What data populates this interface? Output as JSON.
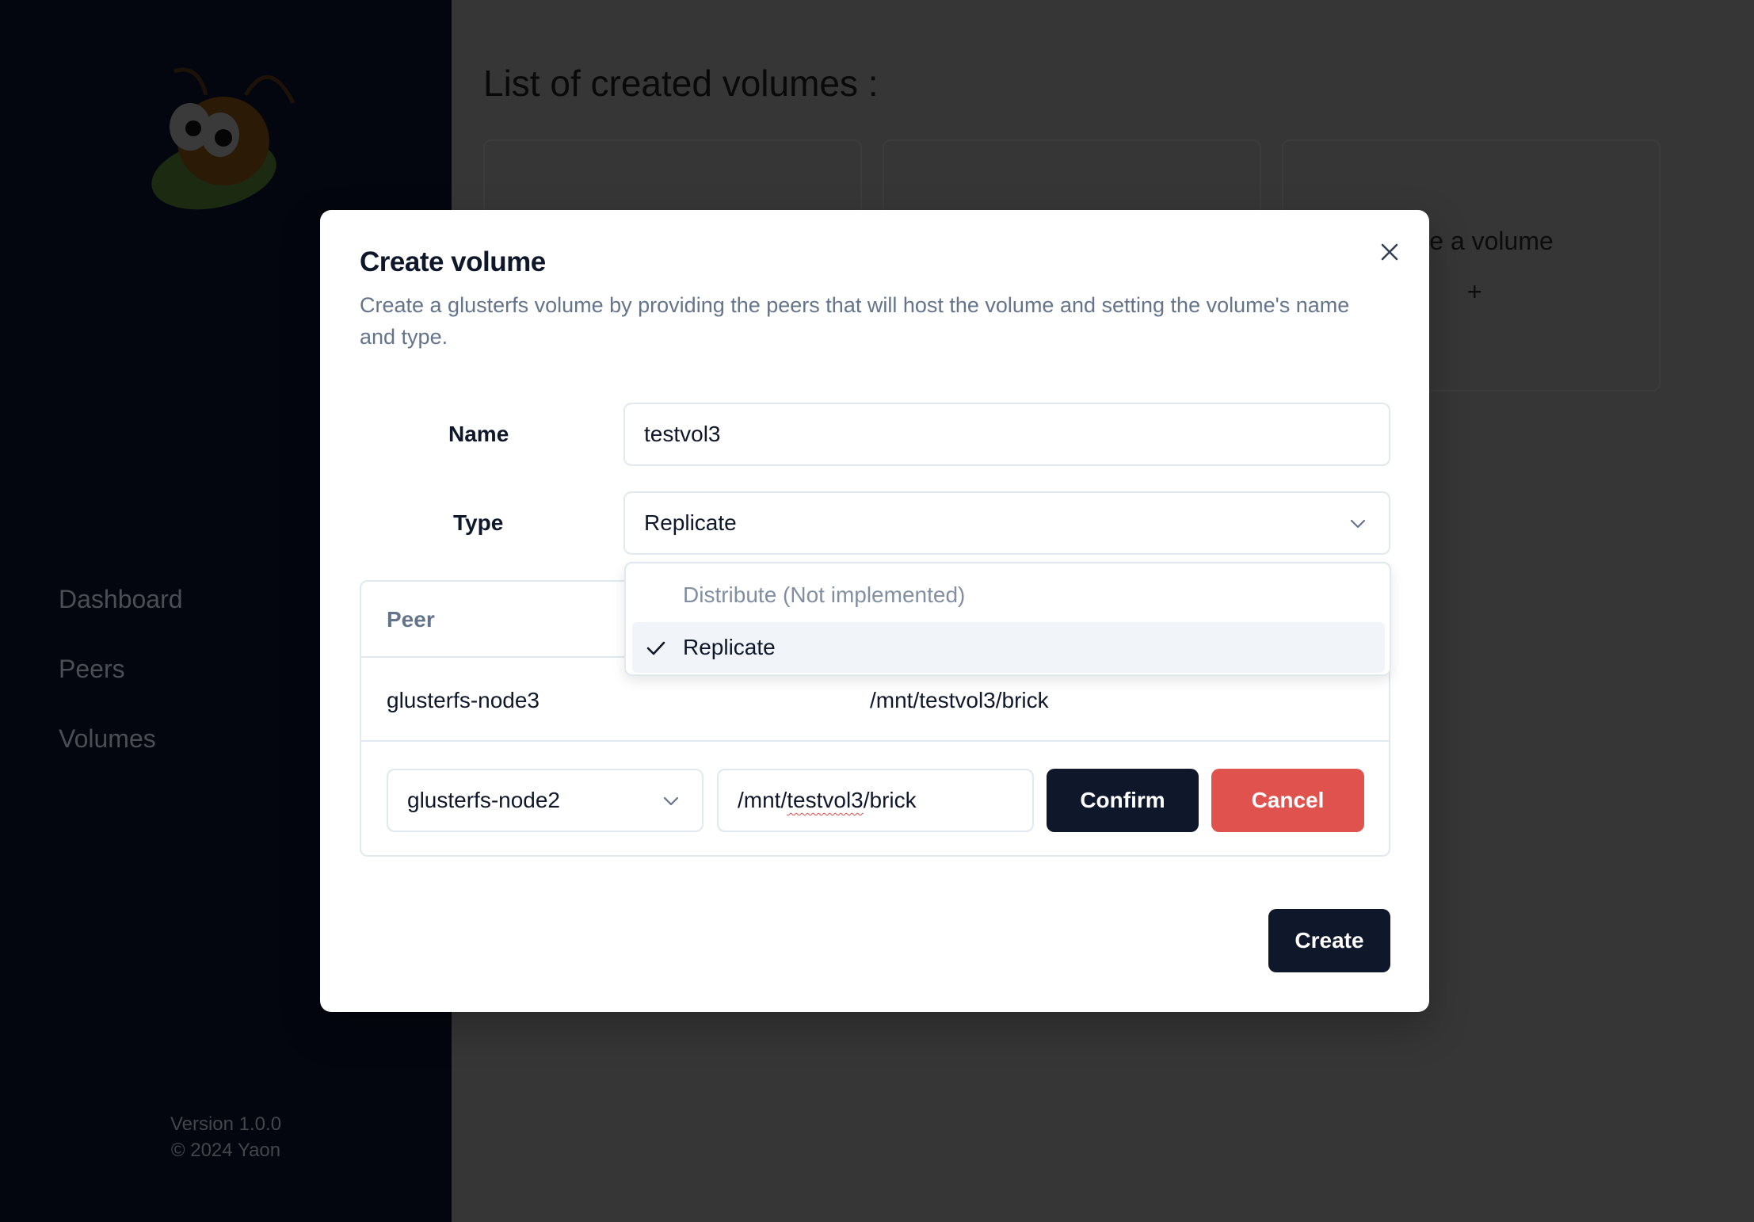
{
  "sidebar": {
    "nav": [
      "Dashboard",
      "Peers",
      "Volumes"
    ],
    "footer": {
      "version": "Version 1.0.0",
      "copyright": "© 2024 Yaon"
    }
  },
  "main": {
    "title": "List of created volumes :",
    "create_card": {
      "label": "Create a volume",
      "plus": "+"
    }
  },
  "modal": {
    "title": "Create volume",
    "description": "Create a glusterfs volume by providing the peers that will host the volume and setting the volume's name and type.",
    "name_label": "Name",
    "name_value": "testvol3",
    "type_label": "Type",
    "type_value": "Replicate",
    "type_options": [
      {
        "label": "Distribute (Not implemented)",
        "disabled": true
      },
      {
        "label": "Replicate",
        "selected": true
      }
    ],
    "peer_table": {
      "header": "Peer",
      "rows": [
        {
          "peer": "glusterfs-node3",
          "brick": "/mnt/testvol3/brick"
        }
      ],
      "edit_row": {
        "peer_value": "glusterfs-node2",
        "brick_prefix": "/mnt/",
        "brick_misspelled": "testvol3",
        "brick_suffix": "/brick",
        "confirm_label": "Confirm",
        "cancel_label": "Cancel"
      }
    },
    "create_label": "Create"
  },
  "colors": {
    "primary": "#0f172a",
    "danger": "#e0524e",
    "muted_text": "#64748b",
    "border": "#e2e8f0"
  }
}
